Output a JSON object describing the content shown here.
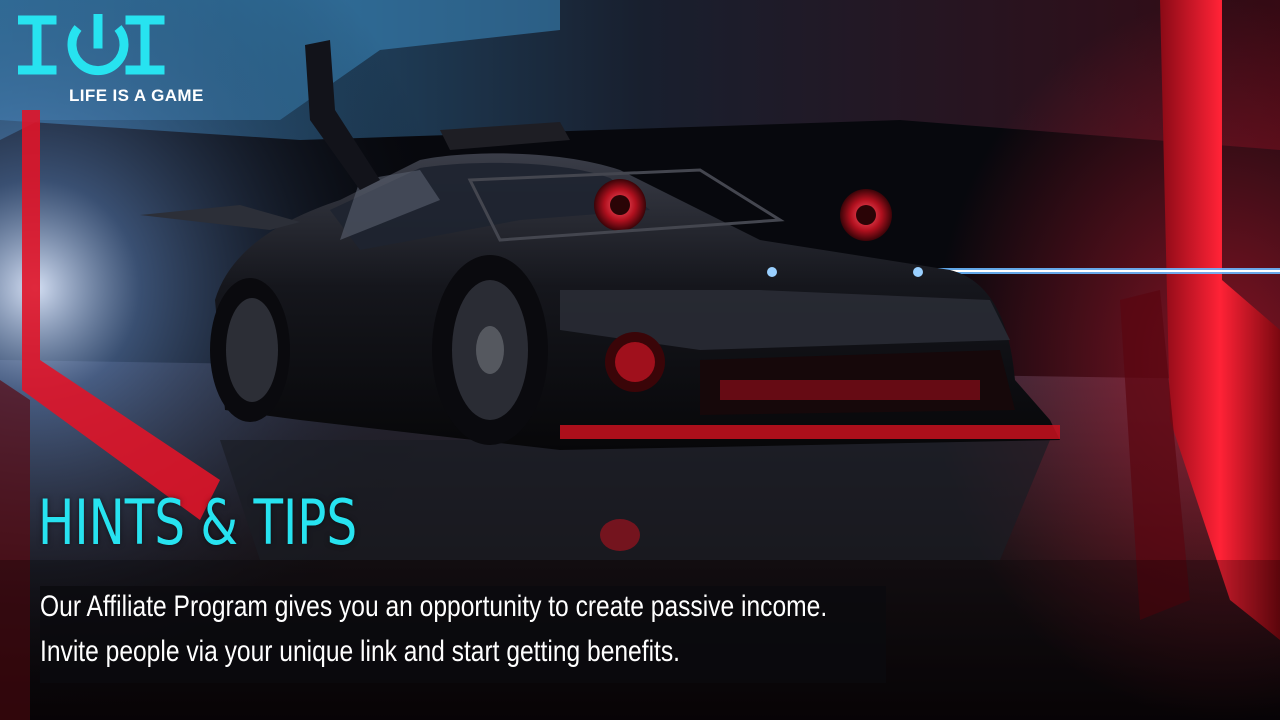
{
  "logo": {
    "mark_text": "IOI",
    "tagline": "LIFE IS A GAME",
    "color": "#27e3f0"
  },
  "hero": {
    "headline": "HINTS & TIPS",
    "headline_color": "#27e3f0",
    "body_lines": [
      "Our Affiliate Program gives you an opportunity to create passive income.",
      "Invite people via your unique link and start getting benefits."
    ]
  },
  "background": {
    "subject": "black tuned sports car with exposed turbochargers in a neon-lit tunnel",
    "accent_red": "#e01428",
    "accent_blue": "#3aa0ff"
  }
}
